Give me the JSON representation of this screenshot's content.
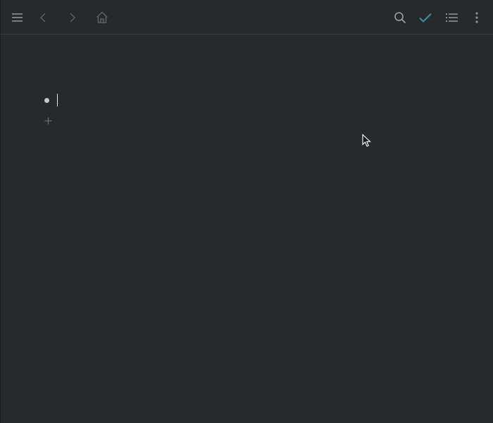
{
  "toolbar": {
    "icons": {
      "menu": "menu-icon",
      "back": "chevron-left-icon",
      "forward": "chevron-right-icon",
      "home": "home-icon",
      "search": "search-icon",
      "done": "check-icon",
      "outline": "list-icon",
      "more": "more-vertical-icon"
    },
    "colors": {
      "icon": "#8b9196",
      "icon_dim": "#5b6166",
      "accent": "#3d8fa3"
    }
  },
  "editor": {
    "blocks": [
      {
        "text": ""
      }
    ]
  },
  "colors": {
    "background": "#262a2d",
    "divider": "#3a3f43",
    "bullet": "#c4c8cb"
  }
}
